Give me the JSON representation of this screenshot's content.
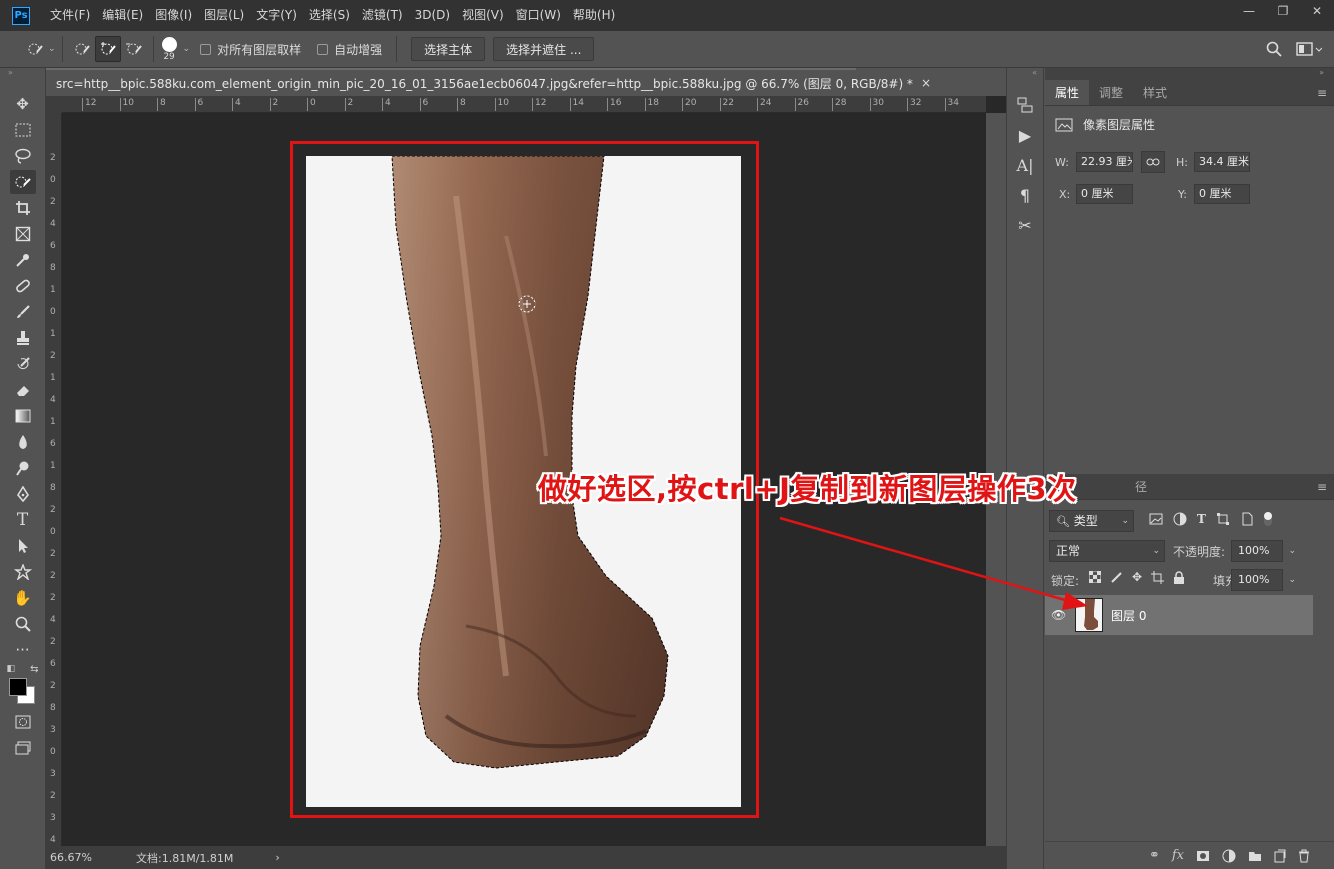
{
  "app": {
    "logo": "Ps"
  },
  "menu": [
    "文件(F)",
    "编辑(E)",
    "图像(I)",
    "图层(L)",
    "文字(Y)",
    "选择(S)",
    "滤镜(T)",
    "3D(D)",
    "视图(V)",
    "窗口(W)",
    "帮助(H)"
  ],
  "window_controls": {
    "minimize": "—",
    "restore": "❐",
    "close": "✕"
  },
  "options": {
    "brush_size": "29",
    "sample_all_layers": "对所有图层取样",
    "auto_enhance": "自动增强",
    "select_subject": "选择主体",
    "select_and_mask": "选择并遮住 ..."
  },
  "document": {
    "tab_title": "src=http__bpic.588ku.com_element_origin_min_pic_20_16_01_3156ae1ecb06047.jpg&refer=http__bpic.588ku.jpg @ 66.7% (图层 0, RGB/8#) *",
    "close": "×",
    "zoom": "66.67%",
    "doc_size": "文档:1.81M/1.81M",
    "status_arrow": "›"
  },
  "rulers": {
    "h_ticks": [
      "12",
      "10",
      "8",
      "6",
      "4",
      "2",
      "0",
      "2",
      "4",
      "6",
      "8",
      "10",
      "12",
      "14",
      "16",
      "18",
      "20",
      "22",
      "24",
      "26",
      "28",
      "30",
      "32",
      "34"
    ],
    "v_ticks": [
      "2",
      "0",
      "2",
      "4",
      "6",
      "8",
      "1",
      "0",
      "1",
      "2",
      "1",
      "4",
      "1",
      "6",
      "1",
      "8",
      "2",
      "0",
      "2",
      "2",
      "2",
      "4",
      "2",
      "6",
      "2",
      "8",
      "3",
      "0",
      "3",
      "2",
      "3",
      "4"
    ]
  },
  "properties": {
    "tabs": [
      "属性",
      "调整",
      "样式"
    ],
    "heading": "像素图层属性",
    "w_label": "W:",
    "w_value": "22.93 厘米",
    "h_label": "H:",
    "h_value": "34.4 厘米",
    "x_label": "X:",
    "x_value": "0 厘米",
    "y_label": "Y:",
    "y_value": "0 厘米"
  },
  "layers": {
    "tab_fragment": "径",
    "filter_kind": "类型",
    "blend_mode": "正常",
    "opacity_label": "不透明度:",
    "opacity_value": "100%",
    "lock_label": "锁定:",
    "fill_label": "填充:",
    "fill_value": "100%",
    "layer_name": "图层 0"
  },
  "annotation": {
    "text": "做好选区,按ctrl+J复制到新图层操作3次",
    "color": "#e01414"
  },
  "colors": {
    "panel": "#535353",
    "menubar": "#323232",
    "canvas_bg": "#282828",
    "highlight_red": "#e01414"
  }
}
